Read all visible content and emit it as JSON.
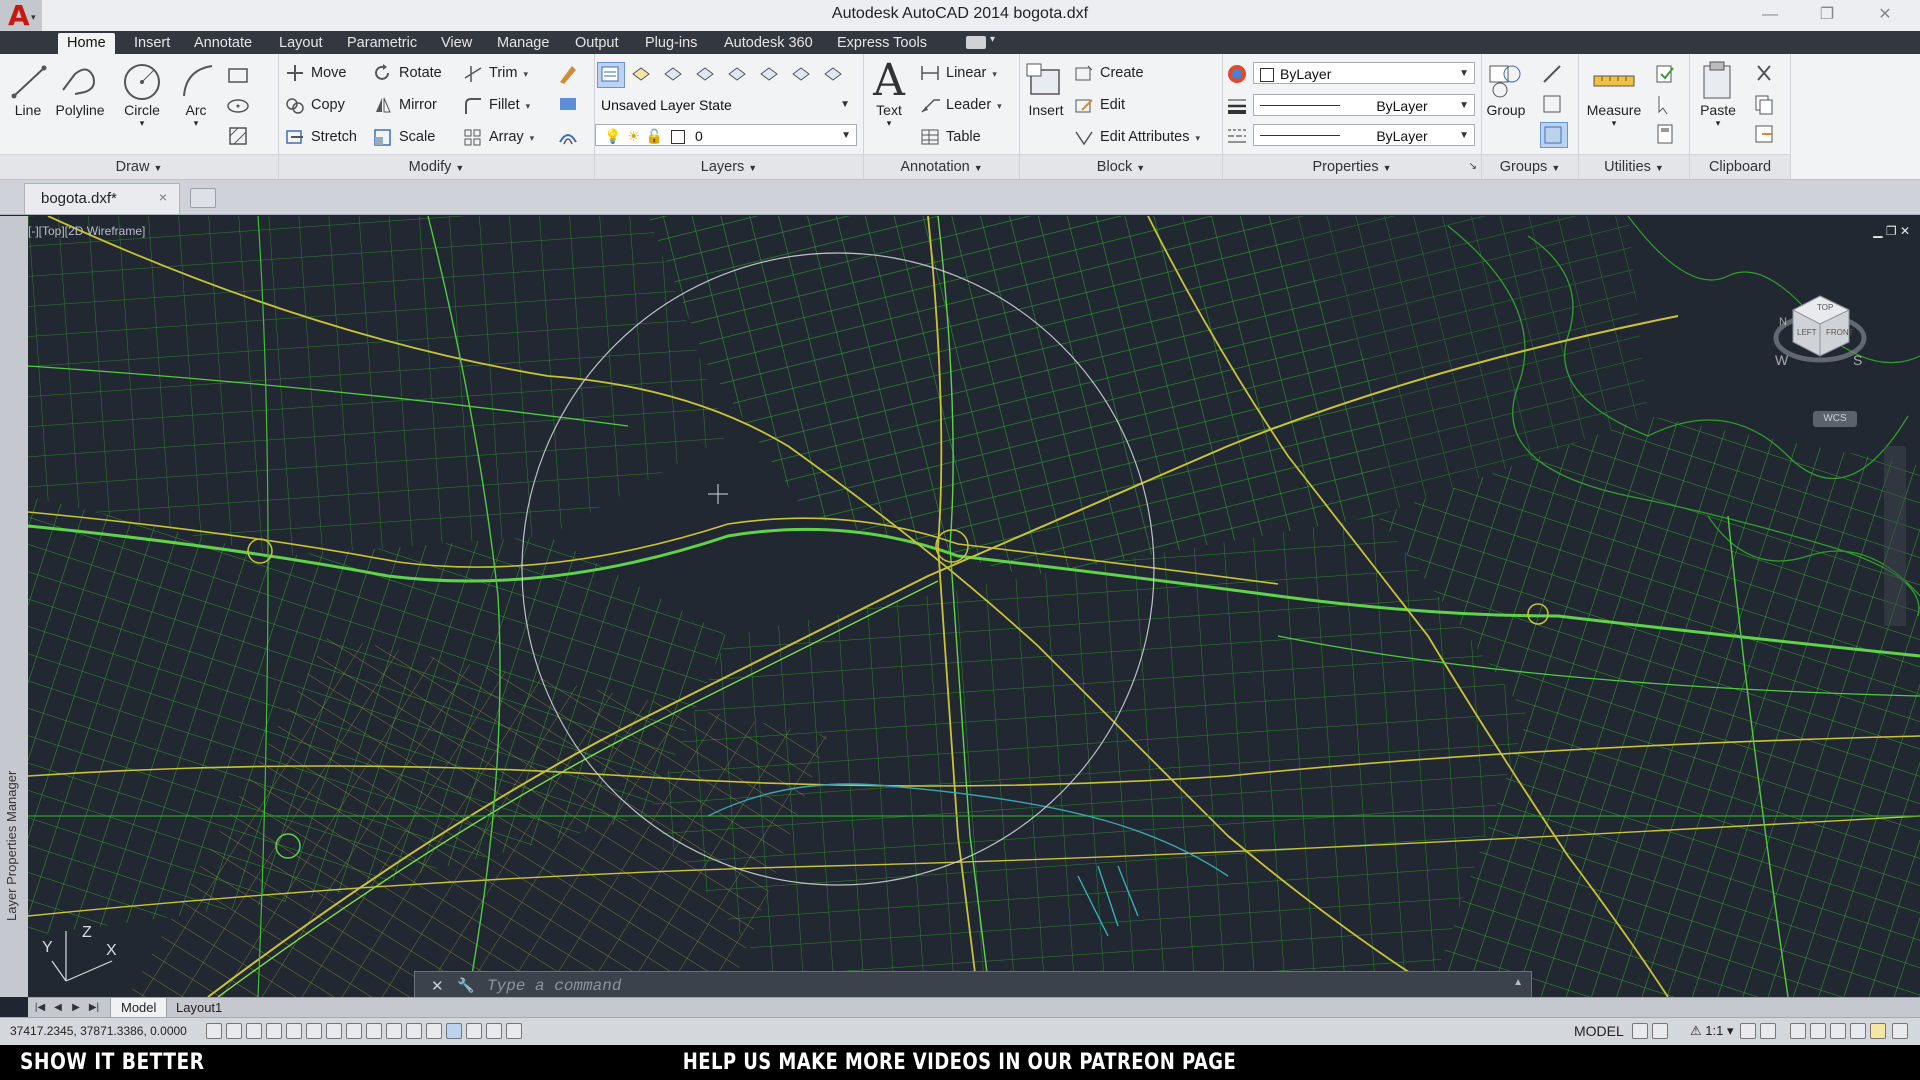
{
  "app": {
    "title": "Autodesk AutoCAD 2014    bogota.dxf",
    "logo_letter": "A",
    "window_controls": [
      "minimize-icon",
      "restore-icon",
      "close-icon"
    ]
  },
  "ribbon_tabs": [
    {
      "label": "Home",
      "active": true
    },
    {
      "label": "Insert"
    },
    {
      "label": "Annotate"
    },
    {
      "label": "Layout"
    },
    {
      "label": "Parametric"
    },
    {
      "label": "View"
    },
    {
      "label": "Manage"
    },
    {
      "label": "Output"
    },
    {
      "label": "Plug-ins"
    },
    {
      "label": "Autodesk 360"
    },
    {
      "label": "Express Tools"
    }
  ],
  "draw": {
    "title": "Draw",
    "line": "Line",
    "polyline": "Polyline",
    "circle": "Circle",
    "arc": "Arc"
  },
  "modify": {
    "title": "Modify",
    "move": "Move",
    "copy": "Copy",
    "stretch": "Stretch",
    "rotate": "Rotate",
    "mirror": "Mirror",
    "scale": "Scale",
    "trim": "Trim",
    "fillet": "Fillet",
    "array": "Array"
  },
  "layers": {
    "title": "Layers",
    "layer_state": "Unsaved Layer State",
    "current_layer": "0"
  },
  "annotation": {
    "title": "Annotation",
    "text": "Text",
    "linear": "Linear",
    "leader": "Leader",
    "table": "Table"
  },
  "block": {
    "title": "Block",
    "insert": "Insert",
    "create": "Create",
    "edit": "Edit",
    "edit_attributes": "Edit Attributes"
  },
  "properties": {
    "title": "Properties",
    "color": "ByLayer",
    "lineweight": "ByLayer",
    "linetype": "ByLayer"
  },
  "groups": {
    "title": "Groups",
    "group": "Group"
  },
  "utilities": {
    "title": "Utilities",
    "measure": "Measure"
  },
  "clipboard": {
    "title": "Clipboard",
    "paste": "Paste"
  },
  "file_tab": {
    "name": "bogota.dxf*",
    "close": "×"
  },
  "viewport": {
    "label": "[-][Top][2D Wireframe]",
    "side_palette": "Layer Properties Manager",
    "viewcube": {
      "top": "TOP",
      "left": "LEFT",
      "front": "FRONT",
      "west": "W",
      "south": "S",
      "north": "N",
      "wcs": "WCS"
    },
    "ucs": {
      "x": "X",
      "y": "Y",
      "z": "Z"
    },
    "colors": {
      "background": "#222832",
      "roads_green": "#35c42a",
      "roads_yellow": "#c9c33a",
      "circle": "#d8dadf"
    }
  },
  "command_line": {
    "prompt": "Type a command"
  },
  "layout_tabs": [
    "Model",
    "Layout1"
  ],
  "status": {
    "coords": "37417.2345, 37871.3386, 0.0000",
    "model": "MODEL",
    "scale": "1:1"
  },
  "overlay": {
    "left": "SHOW IT BETTER",
    "center": "HELP US MAKE MORE VIDEOS IN OUR PATREON PAGE"
  }
}
